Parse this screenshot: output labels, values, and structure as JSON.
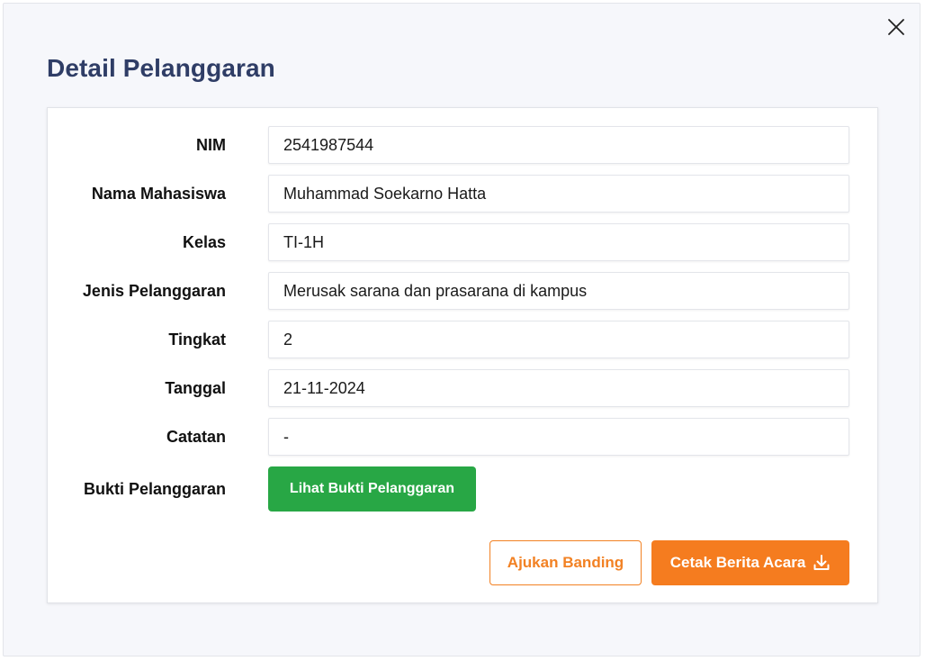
{
  "modal": {
    "title": "Detail Pelanggaran",
    "close_icon": "close-icon"
  },
  "fields": [
    {
      "label": "NIM",
      "value": "2541987544"
    },
    {
      "label": "Nama Mahasiswa",
      "value": "Muhammad Soekarno Hatta"
    },
    {
      "label": "Kelas",
      "value": "TI-1H"
    },
    {
      "label": "Jenis Pelanggaran",
      "value": "Merusak sarana dan prasarana di kampus"
    },
    {
      "label": "Tingkat",
      "value": "2"
    },
    {
      "label": "Tanggal",
      "value": "21-11-2024"
    },
    {
      "label": "Catatan",
      "value": "-"
    }
  ],
  "evidence": {
    "label": "Bukti Pelanggaran",
    "button_label": "Lihat Bukti Pelanggaran"
  },
  "actions": {
    "appeal_label": "Ajukan Banding",
    "print_label": "Cetak Berita Acara",
    "print_icon": "download-icon"
  },
  "colors": {
    "title": "#2f3d66",
    "green": "#28a745",
    "orange": "#f57c1f"
  }
}
